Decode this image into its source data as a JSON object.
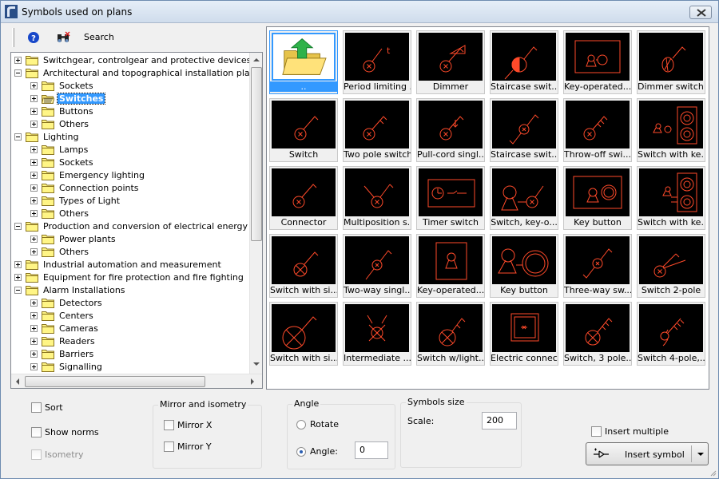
{
  "window": {
    "title": "Symbols used on plans"
  },
  "toolbar": {
    "search_label": "Search"
  },
  "tree": [
    {
      "label": "Switchgear, controlgear and protective devices",
      "level": 0,
      "expander": "plus"
    },
    {
      "label": "Architectural and topographical installation plans and",
      "level": 0,
      "expander": "minus"
    },
    {
      "label": "Sockets",
      "level": 1,
      "expander": "plus"
    },
    {
      "label": "Switches",
      "level": 1,
      "expander": "plus",
      "selected": true,
      "open_folder": true
    },
    {
      "label": "Buttons",
      "level": 1,
      "expander": "plus"
    },
    {
      "label": "Others",
      "level": 1,
      "expander": "plus"
    },
    {
      "label": "Lighting",
      "level": 0,
      "expander": "minus"
    },
    {
      "label": "Lamps",
      "level": 1,
      "expander": "plus"
    },
    {
      "label": "Sockets",
      "level": 1,
      "expander": "plus"
    },
    {
      "label": "Emergency lighting",
      "level": 1,
      "expander": "plus"
    },
    {
      "label": "Connection points",
      "level": 1,
      "expander": "plus"
    },
    {
      "label": "Types of Light",
      "level": 1,
      "expander": "plus"
    },
    {
      "label": "Others",
      "level": 1,
      "expander": "plus"
    },
    {
      "label": "Production and conversion of electrical energy",
      "level": 0,
      "expander": "minus"
    },
    {
      "label": "Power plants",
      "level": 1,
      "expander": "plus"
    },
    {
      "label": "Others",
      "level": 1,
      "expander": "plus"
    },
    {
      "label": "Industrial automation and measurement",
      "level": 0,
      "expander": "plus"
    },
    {
      "label": "Equipment for fire protection and fire fighting",
      "level": 0,
      "expander": "plus"
    },
    {
      "label": "Alarm Installations",
      "level": 0,
      "expander": "minus"
    },
    {
      "label": "Detectors",
      "level": 1,
      "expander": "plus"
    },
    {
      "label": "Centers",
      "level": 1,
      "expander": "plus"
    },
    {
      "label": "Cameras",
      "level": 1,
      "expander": "plus"
    },
    {
      "label": "Readers",
      "level": 1,
      "expander": "plus"
    },
    {
      "label": "Barriers",
      "level": 1,
      "expander": "plus"
    },
    {
      "label": "Signalling",
      "level": 1,
      "expander": "plus"
    }
  ],
  "symbols": [
    {
      "caption": "..",
      "icon": "parent-folder",
      "selected": true
    },
    {
      "caption": "Period limiting ...",
      "icon": "period-limiting"
    },
    {
      "caption": "Dimmer",
      "icon": "dimmer"
    },
    {
      "caption": "Staircase swit...",
      "icon": "staircase-half"
    },
    {
      "caption": "Key-operated...",
      "icon": "key-operated-box"
    },
    {
      "caption": "Dimmer switch...",
      "icon": "dimmer-switch"
    },
    {
      "caption": "Switch",
      "icon": "switch"
    },
    {
      "caption": "Two pole switch",
      "icon": "two-pole"
    },
    {
      "caption": "Pull-cord singl...",
      "icon": "pull-cord"
    },
    {
      "caption": "Staircase swit...",
      "icon": "staircase"
    },
    {
      "caption": "Throw-off swi...",
      "icon": "throw-off"
    },
    {
      "caption": "Switch with ke...",
      "icon": "switch-key-circles"
    },
    {
      "caption": "Connector",
      "icon": "connector"
    },
    {
      "caption": "Multiposition s...",
      "icon": "multiposition"
    },
    {
      "caption": "Timer switch",
      "icon": "timer"
    },
    {
      "caption": "Switch, key-o...",
      "icon": "switch-key-op"
    },
    {
      "caption": "Key button",
      "icon": "key-button-box"
    },
    {
      "caption": "Switch with ke...",
      "icon": "switch-key-circles2"
    },
    {
      "caption": "Switch with si...",
      "icon": "switch-signal"
    },
    {
      "caption": "Two-way singl...",
      "icon": "two-way"
    },
    {
      "caption": "Key-operated...",
      "icon": "key-operated-rect"
    },
    {
      "caption": "Key button",
      "icon": "key-button-big"
    },
    {
      "caption": "Three-way sw...",
      "icon": "three-way"
    },
    {
      "caption": "Switch 2-pole",
      "icon": "switch-2pole"
    },
    {
      "caption": "Switch with si...",
      "icon": "switch-signal-big"
    },
    {
      "caption": "Intermediate ...",
      "icon": "intermediate"
    },
    {
      "caption": "Switch w/light...",
      "icon": "switch-light"
    },
    {
      "caption": "Electric connect",
      "icon": "electric-connect"
    },
    {
      "caption": "Switch, 3 pole...",
      "icon": "switch-3pole"
    },
    {
      "caption": "Switch 4-pole,...",
      "icon": "switch-4pole"
    }
  ],
  "options": {
    "sort": "Sort",
    "show_norms": "Show norms",
    "isometry": "Isometry",
    "mirror_group": "Mirror and isometry",
    "mirror_x": "Mirror X",
    "mirror_y": "Mirror Y",
    "angle_group": "Angle",
    "rotate": "Rotate",
    "angle": "Angle:",
    "angle_value": "0",
    "size_group": "Symbols size",
    "scale_label": "Scale:",
    "scale_value": "200",
    "insert_multiple": "Insert multiple",
    "insert_symbol": "Insert symbol"
  },
  "colors": {
    "symbol_line": "#ff4a2a",
    "selection": "#3399ff",
    "symbol_bg": "#000000"
  }
}
